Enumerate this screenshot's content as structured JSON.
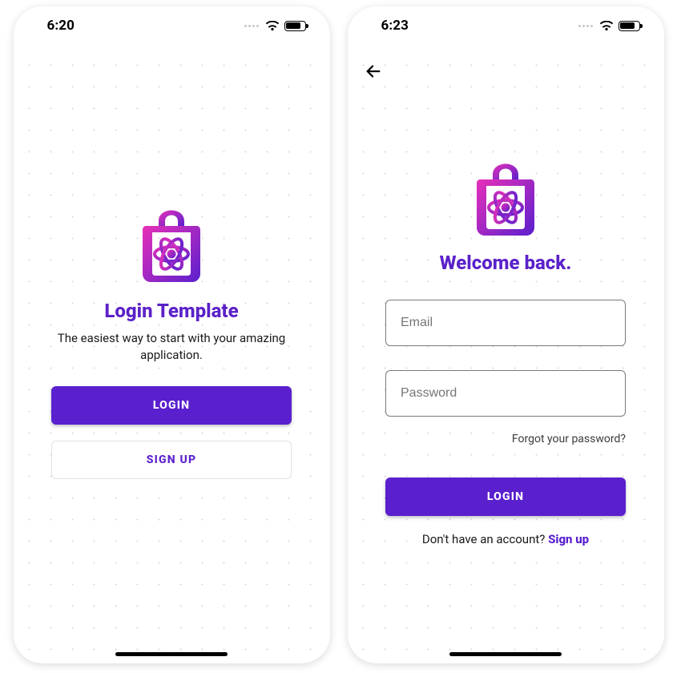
{
  "colors": {
    "accent": "#5a20ce",
    "heading": "#5b21c9"
  },
  "screens": {
    "welcome": {
      "status_time": "6:20",
      "title": "Login Template",
      "subtitle": "The easiest way to start with your amazing application.",
      "login_btn": "LOGIN",
      "signup_btn": "SIGN UP"
    },
    "login": {
      "status_time": "6:23",
      "heading": "Welcome back.",
      "email_placeholder": "Email",
      "password_placeholder": "Password",
      "forgot": "Forgot your password?",
      "login_btn": "LOGIN",
      "no_account_text": "Don't have an account? ",
      "signup_link": "Sign up"
    }
  },
  "icons": {
    "logo": "shopping-bag-atom-icon",
    "back": "arrow-left-icon",
    "wifi": "wifi-icon",
    "battery": "battery-icon"
  }
}
